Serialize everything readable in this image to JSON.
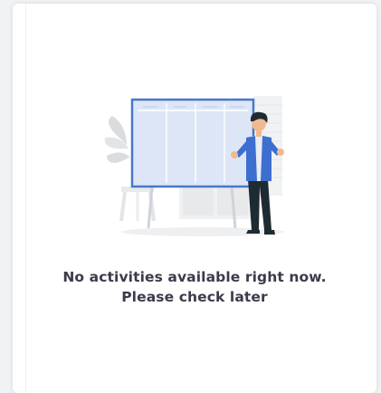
{
  "empty_state": {
    "line1": "No activities available right now.",
    "line2": "Please check later",
    "illustration_icon": "empty-board-person-icon"
  },
  "colors": {
    "background": "#f1f2f4",
    "card": "#ffffff",
    "text": "#3b3b4a",
    "board_fill": "#dce6f7",
    "board_stroke": "#4a77c9",
    "person_vest": "#3d6fd0",
    "person_pants": "#1f2b33"
  }
}
